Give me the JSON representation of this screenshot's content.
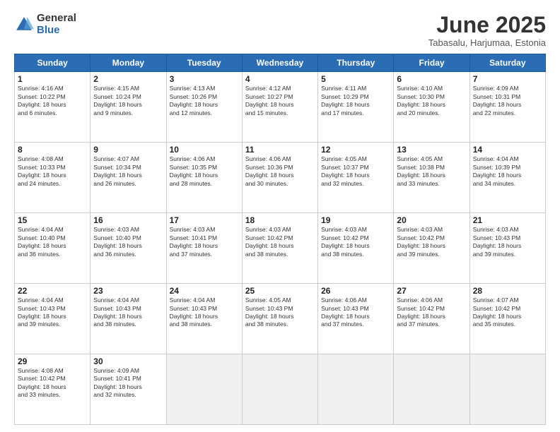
{
  "logo": {
    "general": "General",
    "blue": "Blue"
  },
  "title": "June 2025",
  "subtitle": "Tabasalu, Harjumaa, Estonia",
  "days_of_week": [
    "Sunday",
    "Monday",
    "Tuesday",
    "Wednesday",
    "Thursday",
    "Friday",
    "Saturday"
  ],
  "weeks": [
    [
      {
        "num": "1",
        "info": "Sunrise: 4:16 AM\nSunset: 10:22 PM\nDaylight: 18 hours\nand 6 minutes."
      },
      {
        "num": "2",
        "info": "Sunrise: 4:15 AM\nSunset: 10:24 PM\nDaylight: 18 hours\nand 9 minutes."
      },
      {
        "num": "3",
        "info": "Sunrise: 4:13 AM\nSunset: 10:26 PM\nDaylight: 18 hours\nand 12 minutes."
      },
      {
        "num": "4",
        "info": "Sunrise: 4:12 AM\nSunset: 10:27 PM\nDaylight: 18 hours\nand 15 minutes."
      },
      {
        "num": "5",
        "info": "Sunrise: 4:11 AM\nSunset: 10:29 PM\nDaylight: 18 hours\nand 17 minutes."
      },
      {
        "num": "6",
        "info": "Sunrise: 4:10 AM\nSunset: 10:30 PM\nDaylight: 18 hours\nand 20 minutes."
      },
      {
        "num": "7",
        "info": "Sunrise: 4:09 AM\nSunset: 10:31 PM\nDaylight: 18 hours\nand 22 minutes."
      }
    ],
    [
      {
        "num": "8",
        "info": "Sunrise: 4:08 AM\nSunset: 10:33 PM\nDaylight: 18 hours\nand 24 minutes."
      },
      {
        "num": "9",
        "info": "Sunrise: 4:07 AM\nSunset: 10:34 PM\nDaylight: 18 hours\nand 26 minutes."
      },
      {
        "num": "10",
        "info": "Sunrise: 4:06 AM\nSunset: 10:35 PM\nDaylight: 18 hours\nand 28 minutes."
      },
      {
        "num": "11",
        "info": "Sunrise: 4:06 AM\nSunset: 10:36 PM\nDaylight: 18 hours\nand 30 minutes."
      },
      {
        "num": "12",
        "info": "Sunrise: 4:05 AM\nSunset: 10:37 PM\nDaylight: 18 hours\nand 32 minutes."
      },
      {
        "num": "13",
        "info": "Sunrise: 4:05 AM\nSunset: 10:38 PM\nDaylight: 18 hours\nand 33 minutes."
      },
      {
        "num": "14",
        "info": "Sunrise: 4:04 AM\nSunset: 10:39 PM\nDaylight: 18 hours\nand 34 minutes."
      }
    ],
    [
      {
        "num": "15",
        "info": "Sunrise: 4:04 AM\nSunset: 10:40 PM\nDaylight: 18 hours\nand 36 minutes."
      },
      {
        "num": "16",
        "info": "Sunrise: 4:03 AM\nSunset: 10:40 PM\nDaylight: 18 hours\nand 36 minutes."
      },
      {
        "num": "17",
        "info": "Sunrise: 4:03 AM\nSunset: 10:41 PM\nDaylight: 18 hours\nand 37 minutes."
      },
      {
        "num": "18",
        "info": "Sunrise: 4:03 AM\nSunset: 10:42 PM\nDaylight: 18 hours\nand 38 minutes."
      },
      {
        "num": "19",
        "info": "Sunrise: 4:03 AM\nSunset: 10:42 PM\nDaylight: 18 hours\nand 38 minutes."
      },
      {
        "num": "20",
        "info": "Sunrise: 4:03 AM\nSunset: 10:42 PM\nDaylight: 18 hours\nand 39 minutes."
      },
      {
        "num": "21",
        "info": "Sunrise: 4:03 AM\nSunset: 10:43 PM\nDaylight: 18 hours\nand 39 minutes."
      }
    ],
    [
      {
        "num": "22",
        "info": "Sunrise: 4:04 AM\nSunset: 10:43 PM\nDaylight: 18 hours\nand 39 minutes."
      },
      {
        "num": "23",
        "info": "Sunrise: 4:04 AM\nSunset: 10:43 PM\nDaylight: 18 hours\nand 38 minutes."
      },
      {
        "num": "24",
        "info": "Sunrise: 4:04 AM\nSunset: 10:43 PM\nDaylight: 18 hours\nand 38 minutes."
      },
      {
        "num": "25",
        "info": "Sunrise: 4:05 AM\nSunset: 10:43 PM\nDaylight: 18 hours\nand 38 minutes."
      },
      {
        "num": "26",
        "info": "Sunrise: 4:06 AM\nSunset: 10:43 PM\nDaylight: 18 hours\nand 37 minutes."
      },
      {
        "num": "27",
        "info": "Sunrise: 4:06 AM\nSunset: 10:42 PM\nDaylight: 18 hours\nand 37 minutes."
      },
      {
        "num": "28",
        "info": "Sunrise: 4:07 AM\nSunset: 10:42 PM\nDaylight: 18 hours\nand 35 minutes."
      }
    ],
    [
      {
        "num": "29",
        "info": "Sunrise: 4:08 AM\nSunset: 10:42 PM\nDaylight: 18 hours\nand 33 minutes."
      },
      {
        "num": "30",
        "info": "Sunrise: 4:09 AM\nSunset: 10:41 PM\nDaylight: 18 hours\nand 32 minutes."
      },
      {
        "num": "",
        "info": ""
      },
      {
        "num": "",
        "info": ""
      },
      {
        "num": "",
        "info": ""
      },
      {
        "num": "",
        "info": ""
      },
      {
        "num": "",
        "info": ""
      }
    ]
  ]
}
